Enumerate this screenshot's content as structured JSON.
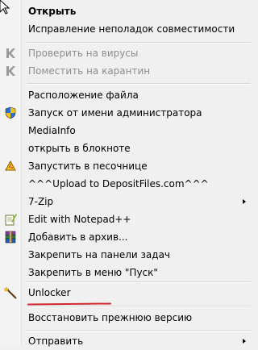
{
  "menu": {
    "items": [
      {
        "label": "Открыть",
        "bold": true
      },
      {
        "label": "Исправление неполадок совместимости"
      },
      {
        "label": "Проверить на вирусы",
        "disabled": true,
        "icon": "kaspersky-icon"
      },
      {
        "label": "Поместить на карантин",
        "disabled": true,
        "icon": "kaspersky-icon"
      },
      {
        "label": "Расположение файла"
      },
      {
        "label": "Запуск от имени администратора",
        "icon": "uac-shield-icon"
      },
      {
        "label": "MediaInfo"
      },
      {
        "label": "открыть в блокноте"
      },
      {
        "label": "Запустить в песочнице",
        "icon": "sandboxie-icon"
      },
      {
        "label": "^^^Upload to DepositFiles.com^^^"
      },
      {
        "label": "7-Zip",
        "submenu": true
      },
      {
        "label": "Edit with Notepad++",
        "icon": "notepad-plus-plus-icon"
      },
      {
        "label": "Добавить в архив...",
        "icon": "winrar-icon"
      },
      {
        "label": "Закрепить на панели задач"
      },
      {
        "label": "Закрепить в меню \"Пуск\""
      },
      {
        "label": "Unlocker",
        "icon": "unlocker-wand-icon"
      },
      {
        "label": "Восстановить прежнюю версию"
      },
      {
        "label": "Отправить",
        "submenu": true
      }
    ]
  },
  "colors": {
    "highlight_underline": "#d4262d",
    "disabled_text": "#8d8d8d"
  }
}
